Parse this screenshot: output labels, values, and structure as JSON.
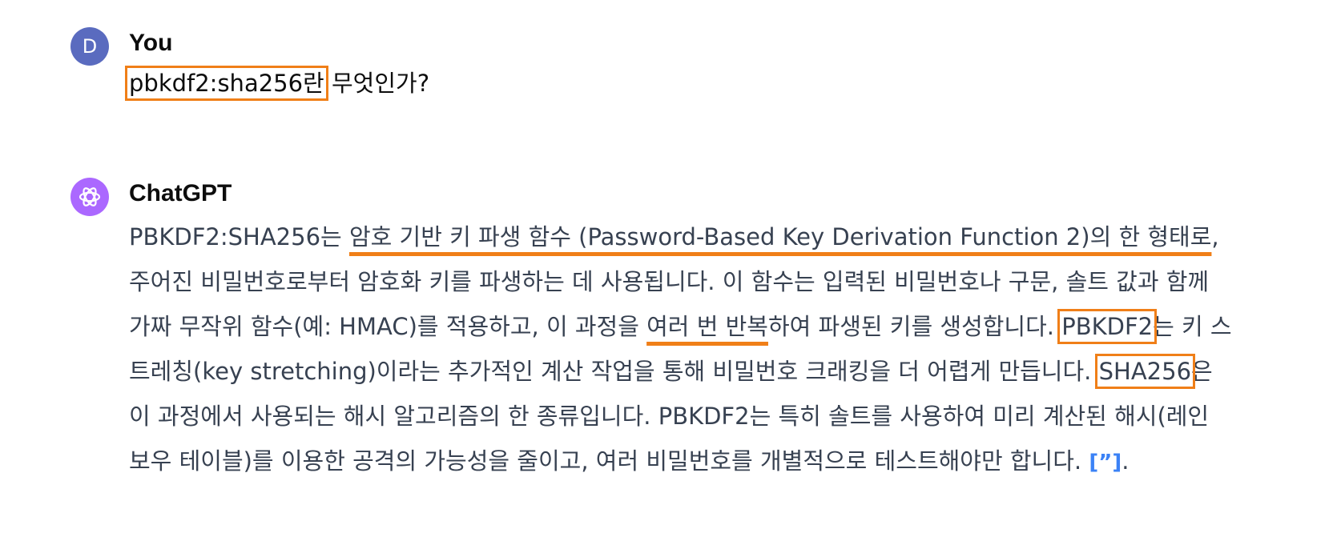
{
  "conversation": {
    "user": {
      "avatar_letter": "D",
      "name": "You",
      "question": {
        "highlighted": "pbkdf2:sha256란",
        "rest": " 무엇인가?"
      }
    },
    "assistant": {
      "name": "ChatGPT",
      "avatar_icon": "openai-logo-icon",
      "answer": {
        "l1": {
          "a": "PBKDF2:SHA256는 ",
          "u": "암호 기반 키 파생 함수 (Password-Based Key Derivation Function 2)의 한 형태로",
          "b": ","
        },
        "l2": "주어진 비밀번호로부터 암호화 키를 파생하는 데 사용됩니다. 이 함수는 입력된 비밀번호나 구문, 솔트 값과 함께",
        "l3": {
          "a": "가짜 무작위 함수(예: HMAC)를 적용하고, 이 과정을 ",
          "u": "여러 번 반복",
          "b": "하여 파생된 키를 생성합니다. ",
          "box": "PBKDF2",
          "c": "는 키 스"
        },
        "l4": {
          "a": "트레칭(key stretching)이라는 추가적인 계산 작업을 통해 비밀번호 크래킹을 더 어렵게 만듭니다. ",
          "box": "SHA256",
          "b": "은"
        },
        "l5": "이 과정에서 사용되는 해시 알고리즘의 한 종류입니다. PBKDF2는 특히 솔트를 사용하여 미리 계산된 해시(레인",
        "l6": {
          "a": "보우 테이블)를 이용한 공격의 가능성을 줄이고, 여러 비밀번호를 개별적으로 테스트해야만 합니다. ",
          "cite": "[”]",
          "b": "."
        }
      }
    }
  },
  "colors": {
    "highlight_box": "#f07f18",
    "user_avatar": "#5a6bbf",
    "assistant_avatar": "#ab68ff",
    "citation": "#3b82f6"
  }
}
